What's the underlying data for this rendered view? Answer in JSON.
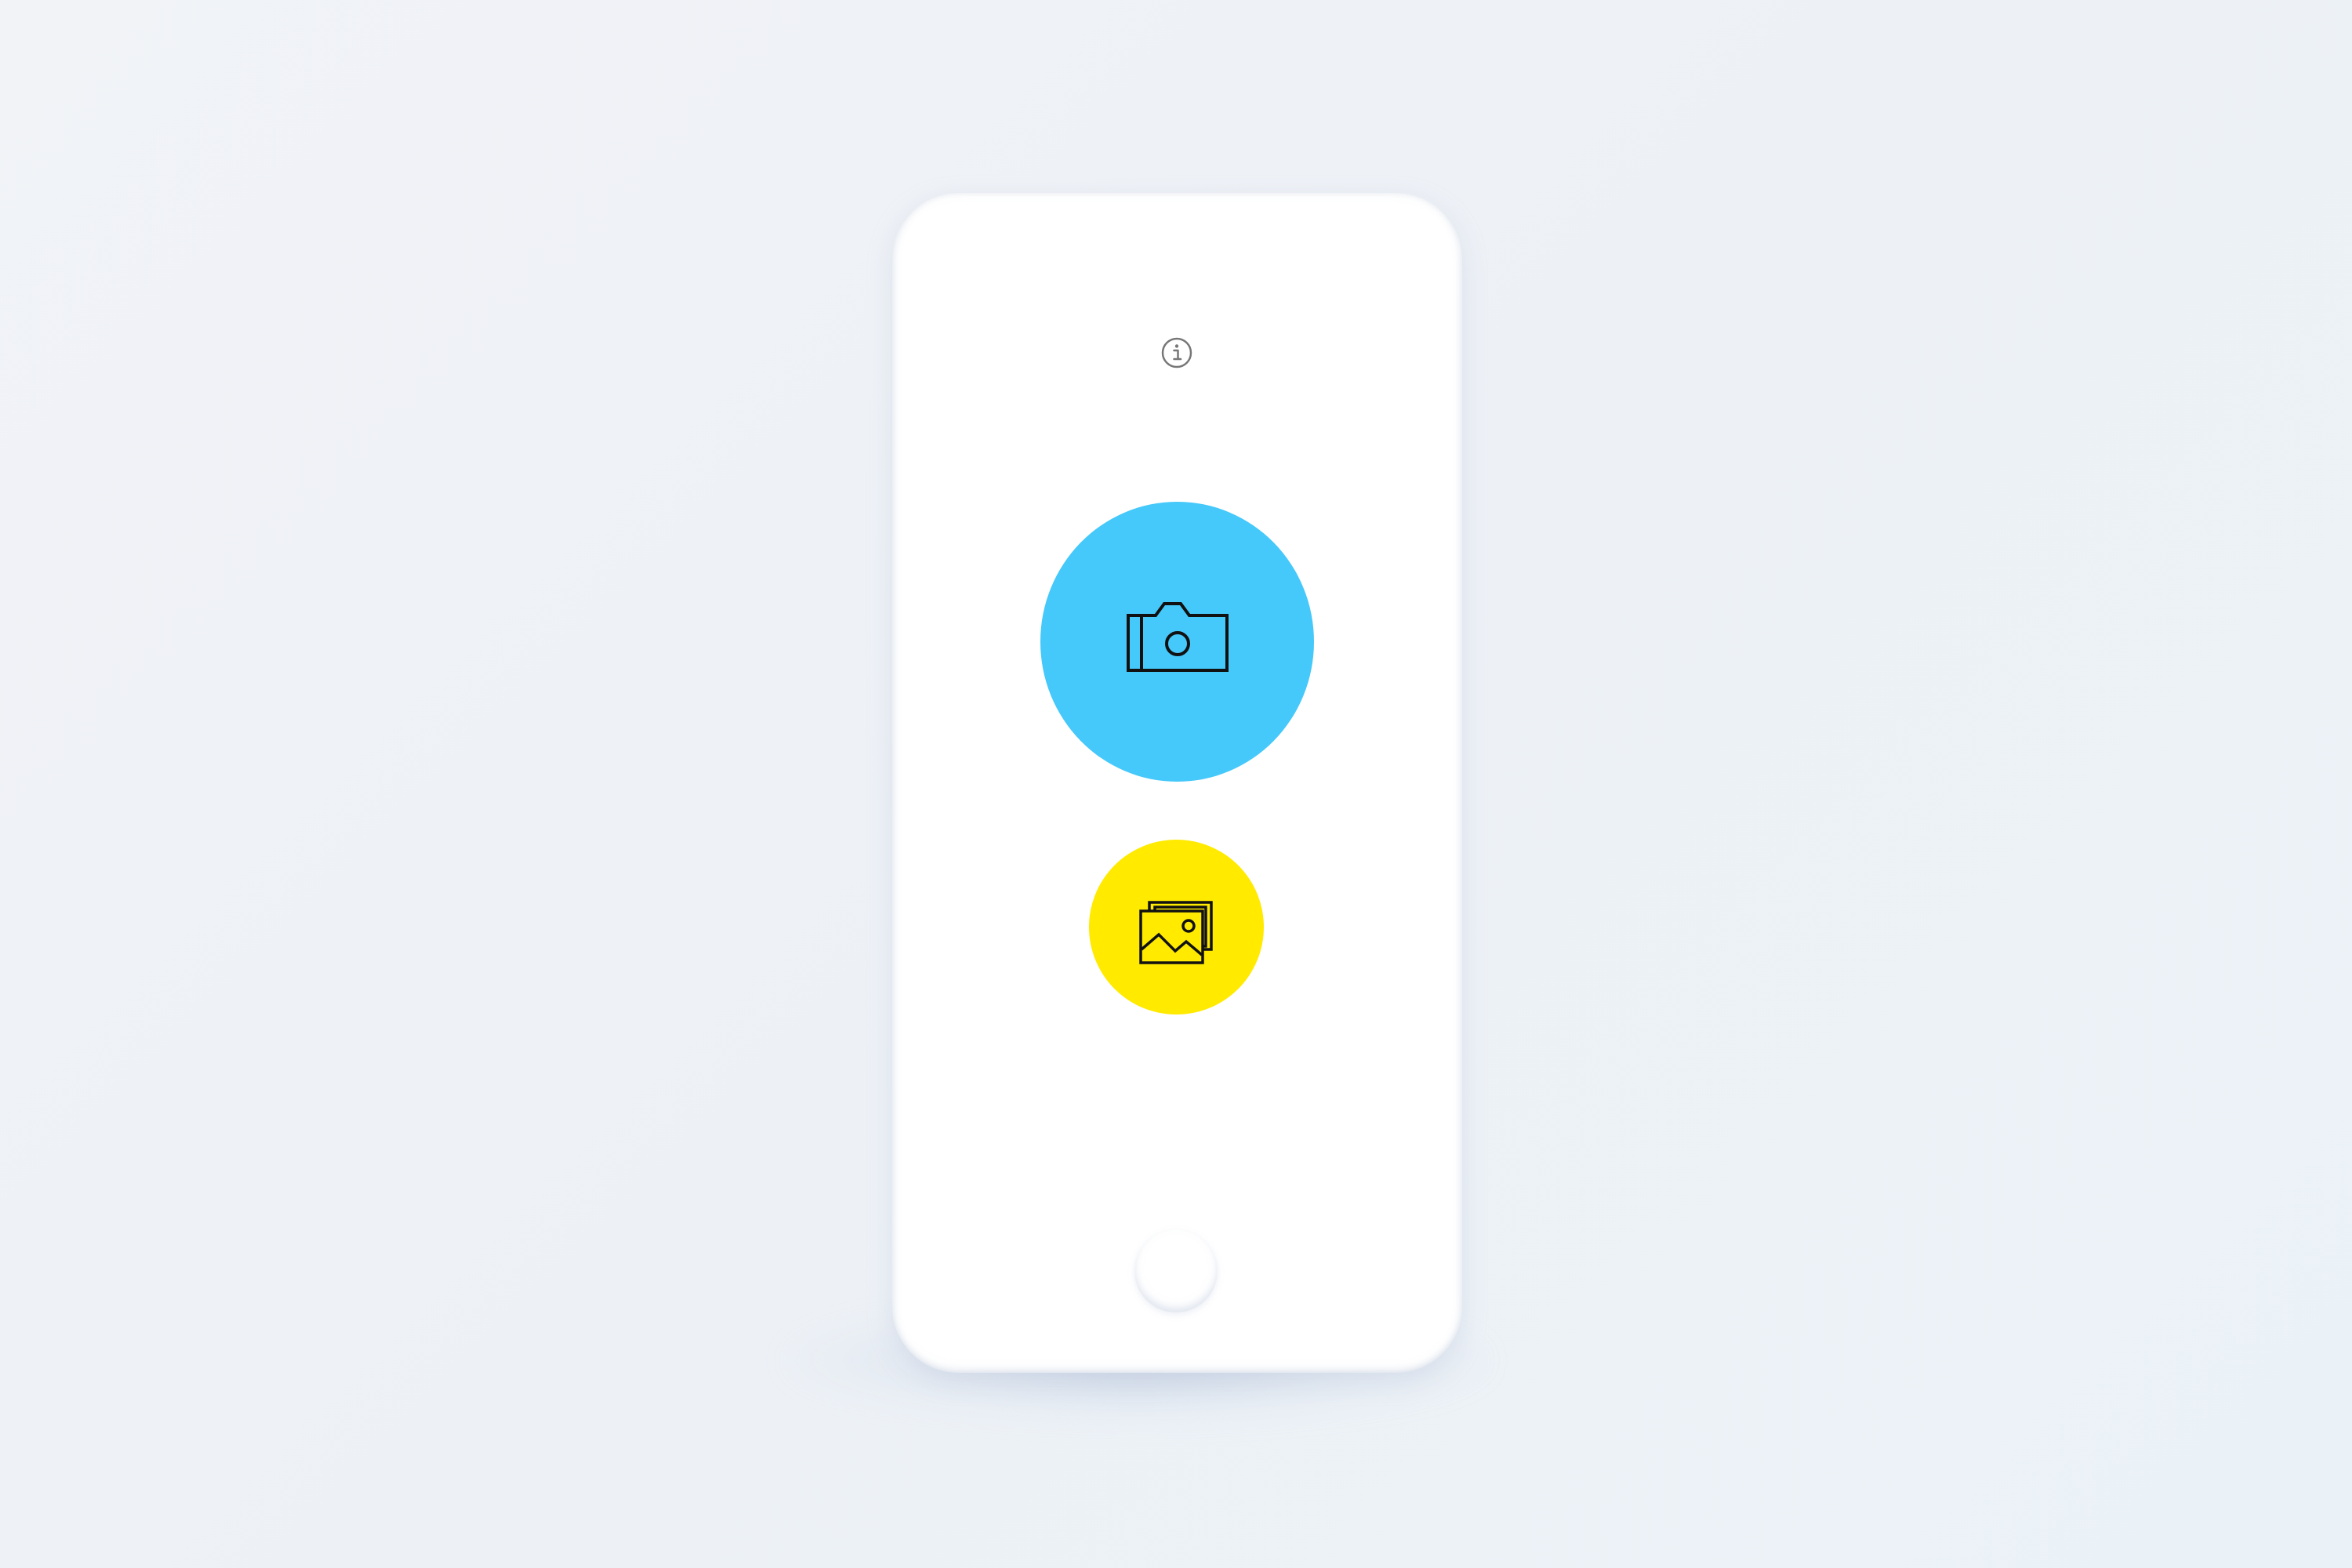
{
  "colors": {
    "background": "#eef2f6",
    "phone_body": "#ffffff",
    "camera_button": "#45c8fa",
    "gallery_button": "#ffea00",
    "icon_stroke": "#111111",
    "info_icon": "#777777"
  },
  "icons": {
    "info": "info-circle-icon",
    "camera": "camera-icon",
    "gallery": "image-gallery-icon"
  }
}
